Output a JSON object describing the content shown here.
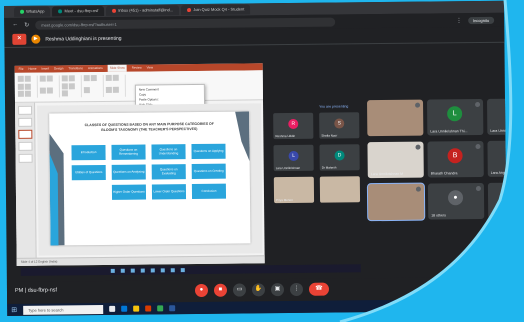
{
  "browser": {
    "tabs": [
      {
        "label": "WhatsApp",
        "color": "#25d366"
      },
      {
        "label": "Meet - dsu-fbrp-nsf",
        "color": "#00897b",
        "active": true
      },
      {
        "label": "Inbox (451) - adminstaff@ind...",
        "color": "#ea4335"
      },
      {
        "label": "Join Quiz Mock Q4 - Student",
        "color": "#ea4335"
      }
    ],
    "url": "meet.google.com/dsu-fbrp-nsf?authuser=1",
    "profile_label": "Incognito"
  },
  "banner": {
    "close_label": "✕",
    "text": "Reshma Uddinghiani is presenting"
  },
  "presentation": {
    "ribbon_tabs": [
      "File",
      "Home",
      "Insert",
      "Design",
      "Transitions",
      "Animations",
      "Slide Show",
      "Review",
      "View"
    ],
    "selected_tab": "Slide Show",
    "context_menu": [
      "New Comment",
      "Copy",
      "Paste Options:",
      "Hide Slide"
    ],
    "slide_title": "CLASSES OF QUESTIONS BASED ON ANY MAIN PURPOSE CATEGORIES OF BLOOM'S TAXONOMY (THE TEACHER'S PERSPECTIVES)",
    "slide_boxes": [
      "Introduction",
      "Questions on Remembering",
      "Questions on Understanding",
      "Questions on Applying",
      "Utilities of Questions",
      "Questions on Analysing",
      "Questions on Evaluating",
      "Questions on Creating",
      "",
      "Higher Order Questions",
      "Lower Order Questions",
      "Conclusion"
    ],
    "status": "Slide 4 of 12   English (India)"
  },
  "side_panel": {
    "label": "You are presenting",
    "tiles": [
      {
        "name": "Reshma Uddin",
        "initial": "R",
        "color": "#e91e63"
      },
      {
        "name": "Shafia Noor",
        "initial": "S",
        "color": "#795548"
      },
      {
        "name": "Lara Unnikrishnan",
        "initial": "L",
        "color": "#3949ab"
      },
      {
        "name": "Dr Mahesh",
        "initial": "D",
        "color": "#00897b"
      },
      {
        "name": "Priya Menon",
        "initial": "",
        "color": ""
      },
      {
        "name": "",
        "initial": "",
        "color": ""
      }
    ]
  },
  "participants": [
    {
      "name": "",
      "initial": "",
      "color": "",
      "type": "photo"
    },
    {
      "name": "Lara Unnikrishnan Thi...",
      "initial": "L",
      "color": "#1e8e3e",
      "type": "avatar"
    },
    {
      "name": "Lara Unnikrishnan",
      "initial": "",
      "color": "#5f6368",
      "type": "avatar"
    },
    {
      "name": "Lara Unnikrishnan M",
      "initial": "",
      "color": "",
      "type": "photo2"
    },
    {
      "name": "Bharath Chandra",
      "initial": "B",
      "color": "#c5221f",
      "type": "avatar"
    },
    {
      "name": "Lara Angel Mary",
      "initial": "",
      "color": "#5f6368",
      "type": "avatar"
    },
    {
      "name": "",
      "initial": "",
      "color": "",
      "type": "photo"
    },
    {
      "name": "18 others",
      "initial": "",
      "color": "",
      "type": "others"
    },
    {
      "name": "You",
      "initial": "",
      "color": "",
      "type": "dark"
    }
  ],
  "meet_bar": {
    "info": "PM | dsu-fbrp-nsf",
    "controls": [
      "mic",
      "cam",
      "cc",
      "hand",
      "present",
      "more"
    ],
    "end_label": "☎"
  },
  "taskbar": {
    "search_placeholder": "Type here to search"
  },
  "colors": {
    "frame": "#1fb6ee",
    "slide_box": "#2aa5dc",
    "ppt_accent": "#b7472a",
    "end_call": "#ea4335"
  }
}
